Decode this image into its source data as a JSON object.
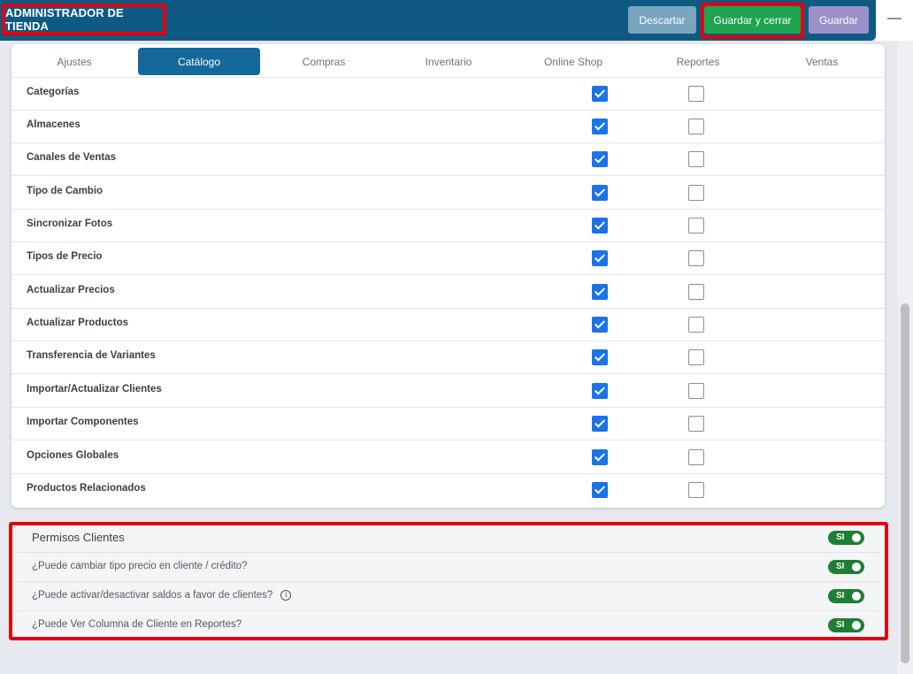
{
  "header": {
    "title": "ADMINISTRADOR DE TIENDA",
    "discard_label": "Descartar",
    "save_close_label": "Guardar y cerrar",
    "save_label": "Guardar",
    "minimize_glyph": "—"
  },
  "tabs": [
    {
      "label": "Ajustes",
      "active": false
    },
    {
      "label": "Catálogo",
      "active": true
    },
    {
      "label": "Compras",
      "active": false
    },
    {
      "label": "Inventario",
      "active": false
    },
    {
      "label": "Online Shop",
      "active": false
    },
    {
      "label": "Reportes",
      "active": false
    },
    {
      "label": "Ventas",
      "active": false
    }
  ],
  "permissions_table": {
    "rows": [
      {
        "label": "Categorías",
        "col1_checked": true,
        "col2_checked": false
      },
      {
        "label": "Almacenes",
        "col1_checked": true,
        "col2_checked": false
      },
      {
        "label": "Canales de Ventas",
        "col1_checked": true,
        "col2_checked": false
      },
      {
        "label": "Tipo de Cambio",
        "col1_checked": true,
        "col2_checked": false
      },
      {
        "label": "Sincronizar Fotos",
        "col1_checked": true,
        "col2_checked": false
      },
      {
        "label": "Tipos de Precio",
        "col1_checked": true,
        "col2_checked": false
      },
      {
        "label": "Actualizar Precios",
        "col1_checked": true,
        "col2_checked": false
      },
      {
        "label": "Actualizar Productos",
        "col1_checked": true,
        "col2_checked": false
      },
      {
        "label": "Transferencia de Variantes",
        "col1_checked": true,
        "col2_checked": false
      },
      {
        "label": "Importar/Actualizar Clientes",
        "col1_checked": true,
        "col2_checked": false
      },
      {
        "label": "Importar Componentes",
        "col1_checked": true,
        "col2_checked": false
      },
      {
        "label": "Opciones Globales",
        "col1_checked": true,
        "col2_checked": false
      },
      {
        "label": "Productos Relacionados",
        "col1_checked": true,
        "col2_checked": false
      }
    ]
  },
  "clients_permissions": {
    "heading": "Permisos Clientes",
    "heading_toggle": "SI",
    "items": [
      {
        "label": "¿Puede cambiar tipo precio en cliente / crédito?",
        "toggle": "SI",
        "info": false
      },
      {
        "label": "¿Puede activar/desactivar saldos a favor de clientes?",
        "toggle": "SI",
        "info": true
      },
      {
        "label": "¿Puede Ver Columna de Cliente en Reportes?",
        "toggle": "SI",
        "info": false
      }
    ]
  },
  "colors": {
    "header_bg": "#0e5a84",
    "active_tab": "#14689a",
    "save_close": "#1ea44f",
    "discard": "#7aa5be",
    "save": "#9b92c9",
    "checkbox_on": "#1a73e8",
    "toggle_on": "#1e7e34",
    "highlight": "#e3000f"
  },
  "icons": {
    "info": "info-circle-icon",
    "check": "check-icon",
    "minimize": "minimize-icon"
  }
}
